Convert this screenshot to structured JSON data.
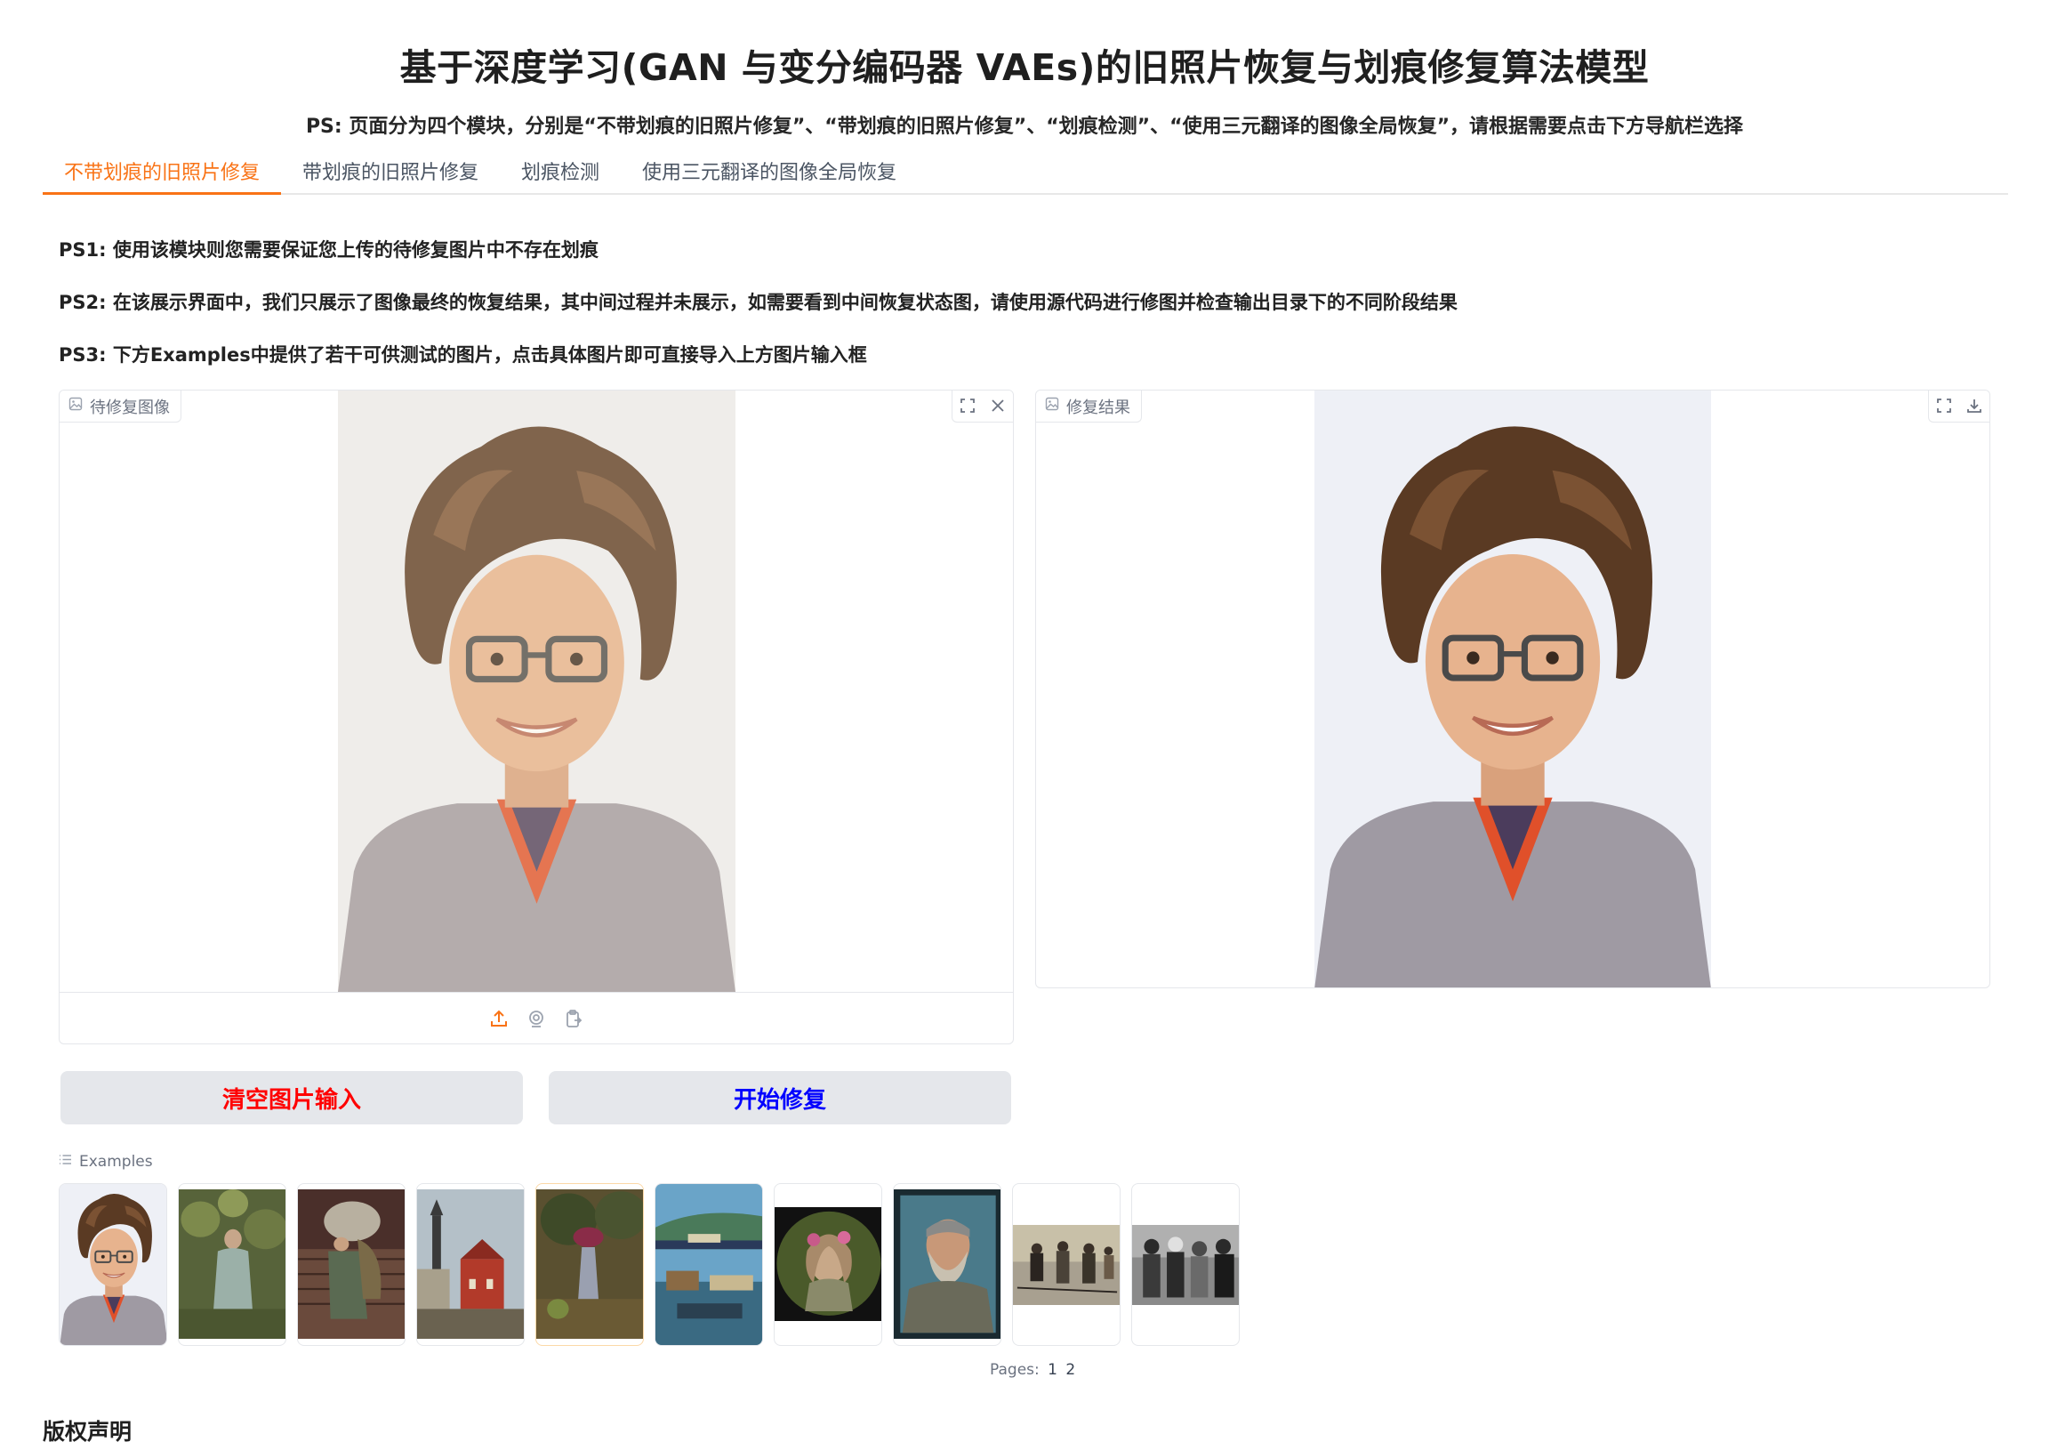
{
  "header": {
    "title": "基于深度学习(GAN 与变分编码器 VAEs)的旧照片恢复与划痕修复算法模型",
    "ps": "PS: 页面分为四个模块，分别是“不带划痕的旧照片修复”、“带划痕的旧照片修复”、“划痕检测”、“使用三元翻译的图像全局恢复”，请根据需要点击下方导航栏选择"
  },
  "tabs": [
    "不带划痕的旧照片修复",
    "带划痕的旧照片修复",
    "划痕检测",
    "使用三元翻译的图像全局恢复"
  ],
  "notes": [
    "PS1: 使用该模块则您需要保证您上传的待修复图片中不存在划痕",
    "PS2: 在该展示界面中，我们只展示了图像最终的恢复结果，其中间过程并未展示，如需要看到中间恢复状态图，请使用源代码进行修图并检查输出目录下的不同阶段结果",
    "PS3: 下方Examples中提供了若干可供测试的图片，点击具体图片即可直接导入上方图片输入框"
  ],
  "input_panel": {
    "label": "待修复图像"
  },
  "output_panel": {
    "label": "修复结果"
  },
  "buttons": {
    "clear": "清空图片输入",
    "start": "开始修复",
    "clear_color": "#ff0000",
    "start_color": "#0000ff"
  },
  "examples": {
    "label": "Examples",
    "pages_label": "Pages:",
    "pages": [
      "1",
      "2"
    ]
  },
  "footer": {
    "heading": "版权声明"
  },
  "colors": {
    "accent": "#f97316"
  }
}
